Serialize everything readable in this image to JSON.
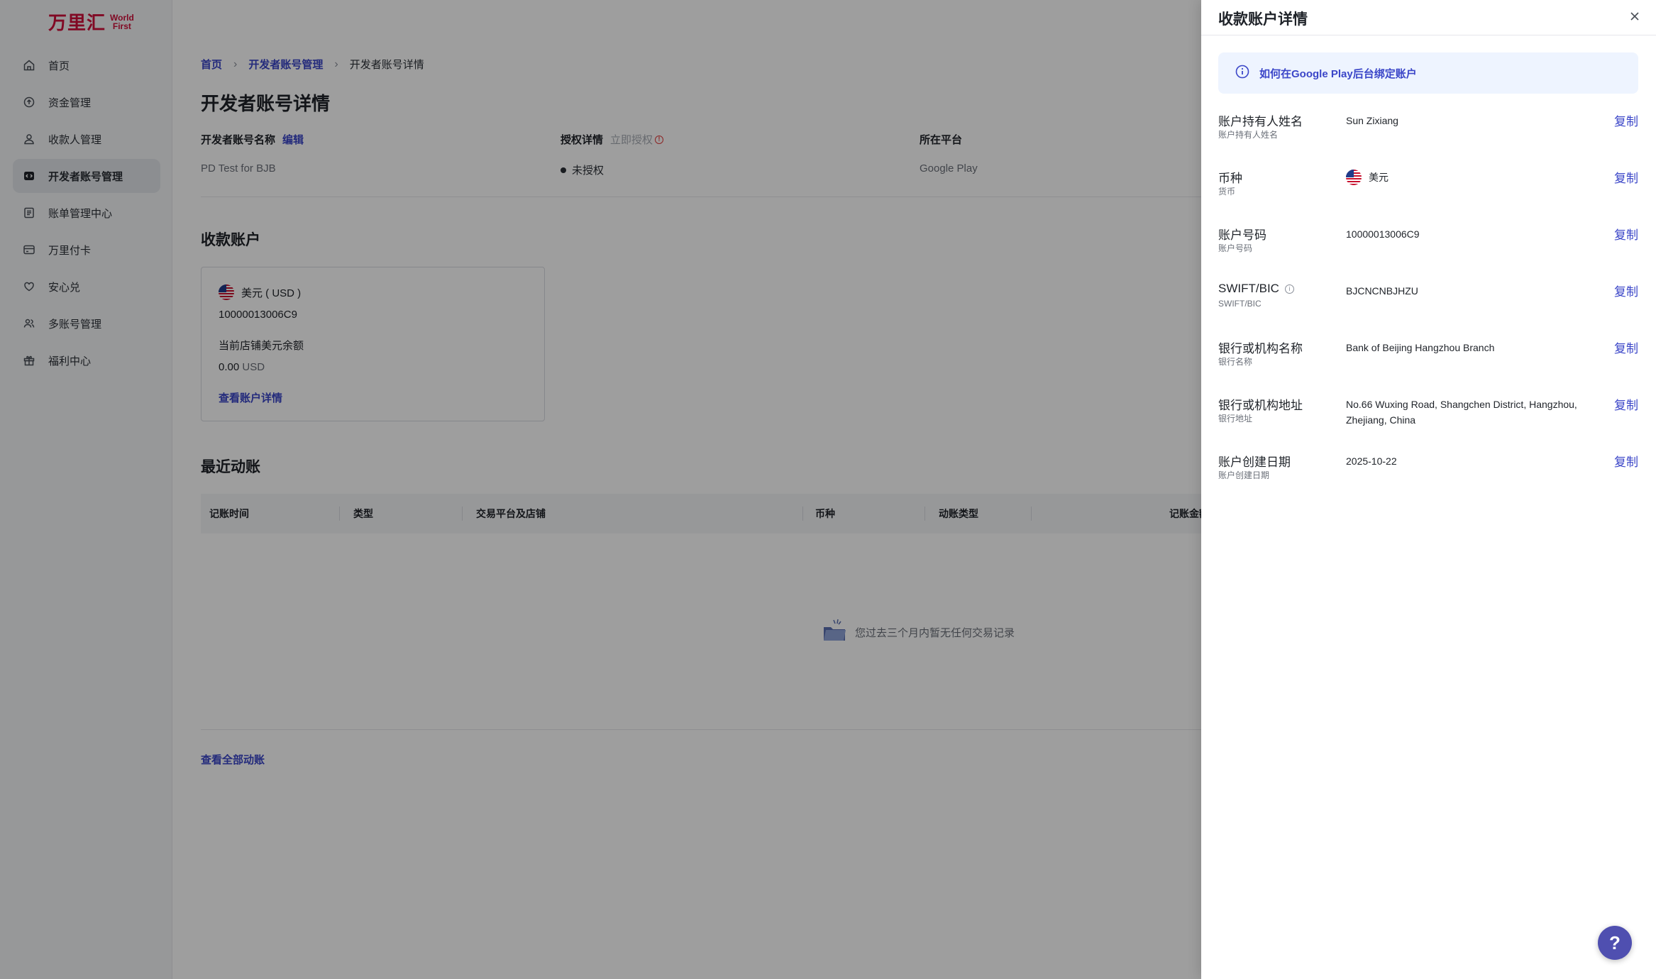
{
  "brand": {
    "name_cn": "万里汇",
    "name_en_1": "World",
    "name_en_2": "First",
    "color": "#d0103a"
  },
  "sidebar": {
    "items": [
      {
        "label": "首页",
        "icon": "home-icon"
      },
      {
        "label": "资金管理",
        "icon": "funds-icon"
      },
      {
        "label": "收款人管理",
        "icon": "payee-icon"
      },
      {
        "label": "开发者账号管理",
        "icon": "developer-icon",
        "active": true
      },
      {
        "label": "账单管理中心",
        "icon": "bill-icon"
      },
      {
        "label": "万里付卡",
        "icon": "card-icon"
      },
      {
        "label": "安心兑",
        "icon": "exchange-icon"
      },
      {
        "label": "多账号管理",
        "icon": "multi-account-icon"
      },
      {
        "label": "福利中心",
        "icon": "gift-icon"
      }
    ]
  },
  "breadcrumb": {
    "home": "首页",
    "parent": "开发者账号管理",
    "current": "开发者账号详情"
  },
  "page": {
    "title": "开发者账号详情",
    "account_name_label": "开发者账号名称",
    "edit_link": "编辑",
    "account_name_value": "PD Test for BJB",
    "auth_label": "授权详情",
    "auth_action": "立即授权",
    "auth_status": "未授权",
    "platform_label": "所在平台",
    "platform_value": "Google Play"
  },
  "receiving": {
    "title": "收款账户",
    "currency": "美元 ( USD )",
    "account_number": "10000013006C9",
    "balance_label": "当前店铺美元余额",
    "balance_amount": "0.00",
    "balance_unit": "USD",
    "detail_link": "查看账户详情"
  },
  "transactions": {
    "title": "最近动账",
    "columns": [
      "记账时间",
      "类型",
      "交易平台及店铺",
      "币种",
      "动账类型",
      "记账金额"
    ],
    "empty_text": "您过去三个月内暂无任何交易记录",
    "all_link": "查看全部动账"
  },
  "drawer": {
    "title": "收款账户详情",
    "notice": "如何在Google Play后台绑定账户",
    "copy_label": "复制",
    "fields": [
      {
        "label": "账户持有人姓名",
        "sub": "账户持有人姓名",
        "value": "Sun Zixiang"
      },
      {
        "label": "币种",
        "sub": "货币",
        "value": "美元"
      },
      {
        "label": "账户号码",
        "sub": "账户号码",
        "value": "10000013006C9"
      },
      {
        "label": "SWIFT/BIC",
        "sub": "SWIFT/BIC",
        "value": "BJCNCNBJHZU"
      },
      {
        "label": "银行或机构名称",
        "sub": "银行名称",
        "value": "Bank of Beijing Hangzhou Branch"
      },
      {
        "label": "银行或机构地址",
        "sub": "银行地址",
        "value": "No.66 Wuxing Road, Shangchen District, Hangzhou, Zhejiang, China"
      },
      {
        "label": "账户创建日期",
        "sub": "账户创建日期",
        "value": "2025-10-22"
      }
    ]
  },
  "help": {
    "label": "?"
  },
  "colors": {
    "accent": "#3b46c8",
    "help_button": "#4f4fb0",
    "notice_bg": "#eef4ff"
  }
}
